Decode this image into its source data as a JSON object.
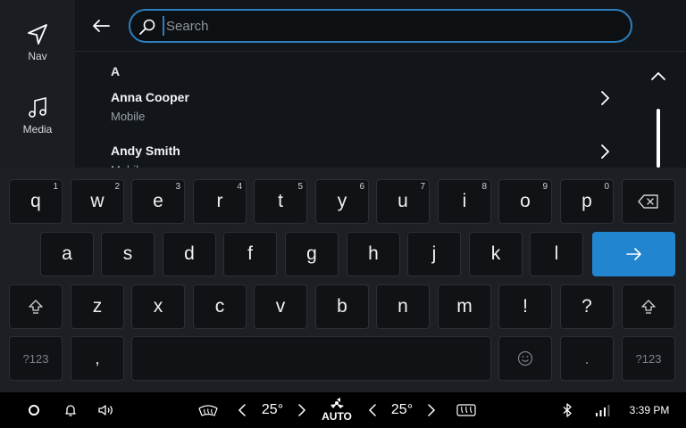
{
  "rail": {
    "items": [
      {
        "label": "Nav",
        "icon": "navigation-arrow-icon"
      },
      {
        "label": "Media",
        "icon": "music-note-icon"
      }
    ]
  },
  "search": {
    "placeholder": "Search",
    "value": ""
  },
  "contacts": {
    "section": "A",
    "items": [
      {
        "name": "Anna Cooper",
        "type": "Mobile"
      },
      {
        "name": "Andy Smith",
        "type": "Mobile"
      }
    ]
  },
  "keyboard": {
    "row1": [
      {
        "label": "q",
        "hint": "1"
      },
      {
        "label": "w",
        "hint": "2"
      },
      {
        "label": "e",
        "hint": "3"
      },
      {
        "label": "r",
        "hint": "4"
      },
      {
        "label": "t",
        "hint": "5"
      },
      {
        "label": "y",
        "hint": "6"
      },
      {
        "label": "u",
        "hint": "7"
      },
      {
        "label": "i",
        "hint": "8"
      },
      {
        "label": "o",
        "hint": "9"
      },
      {
        "label": "p",
        "hint": "0"
      }
    ],
    "row2": [
      "a",
      "s",
      "d",
      "f",
      "g",
      "h",
      "j",
      "k",
      "l"
    ],
    "row3": [
      "z",
      "x",
      "c",
      "v",
      "b",
      "n",
      "m",
      "!",
      "?"
    ],
    "symbols_label": "?123",
    "comma_label": ",",
    "period_label": "."
  },
  "status": {
    "left_temp": "25°",
    "right_temp": "25°",
    "auto_label": "AUTO",
    "time": "3:39 PM"
  },
  "colors": {
    "accent": "#2185cf",
    "search_border": "#2d7fbf"
  }
}
